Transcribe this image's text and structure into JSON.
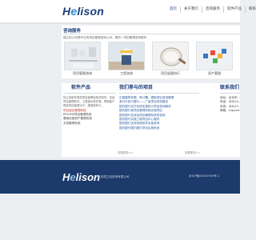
{
  "header": {
    "logo_main": "H",
    "logo_e": "e",
    "logo_rest": "lison",
    "nav": [
      "首页",
      "关于我们",
      "咨询服务",
      "软件产品",
      "联系"
    ]
  },
  "services": {
    "title": "咨询服务",
    "desc": "禧立信公司是专业的项目管理咨询公司，提供一流的管理咨询服务",
    "items": [
      {
        "caption": "项目管理咨询"
      },
      {
        "caption": "工程咨询"
      },
      {
        "caption": "项目监理执行"
      },
      {
        "caption": "资产管理"
      }
    ]
  },
  "products": {
    "title": "软件产品",
    "intro": "禧立信软件提供项目管理及相关软件，包括项目管理软件、工程造价软件等，帮助客户提高项目管理水平，增强竞争力。",
    "items": [
      {
        "label": "项目组合管理系统",
        "style": "red"
      },
      {
        "label": "PROMIS项目管理系统",
        "style": "dark"
      },
      {
        "label": "基础设施资产管理系统",
        "style": "dark"
      },
      {
        "label": "文档管理系统",
        "style": "dark"
      }
    ],
    "more": "查看更多>>"
  },
  "projects": {
    "title": "我们参与的项目",
    "items": [
      "中国建筑有限、审计署、德勤项目咨询管理",
      "某分行投行建行——广省项目系统建设",
      "国内银行支付系统实施执行项目咨询服务",
      "国内银行某项目管理系统实施项目",
      "国内银行支持及项目管理系统的咨询",
      "国内银行实施工程项目中心服务",
      "国内银行支持系统软件实施咨询",
      "国内银行国内银行项目实施系统"
    ],
    "more": "查看更多>>"
  },
  "contact": {
    "title": "联系我们",
    "rows": [
      "地址：北京市...",
      "电话：(86)10...",
      "传真：(86)10...",
      "邮箱：support..."
    ]
  },
  "footer": {
    "logo_main": "H",
    "logo_e": "e",
    "logo_rest": "lison",
    "copyright": "北京禧立信咨询有限公司",
    "right": "京ICP备05002949号-1"
  },
  "colors": {
    "brand": "#1c3f7a",
    "accent": "#2a8fd3",
    "footer": "#1c3a6b"
  }
}
